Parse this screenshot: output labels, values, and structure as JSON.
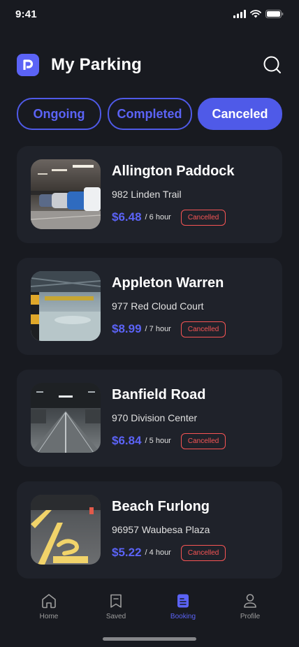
{
  "status_bar": {
    "time": "9:41"
  },
  "header": {
    "title": "My Parking"
  },
  "tabs": [
    {
      "label": "Ongoing",
      "active": false
    },
    {
      "label": "Completed",
      "active": false
    },
    {
      "label": "Canceled",
      "active": true
    }
  ],
  "bookings": [
    {
      "name": "Allington Paddock",
      "address": "982 Linden Trail",
      "price": "$6.48",
      "duration": "/ 6 hour",
      "status": "Cancelled"
    },
    {
      "name": "Appleton Warren",
      "address": "977 Red Cloud Court",
      "price": "$8.99",
      "duration": "/ 7 hour",
      "status": "Cancelled"
    },
    {
      "name": "Banfield Road",
      "address": "970 Division Center",
      "price": "$6.84",
      "duration": "/ 5 hour",
      "status": "Cancelled"
    },
    {
      "name": "Beach Furlong",
      "address": "96957 Waubesa Plaza",
      "price": "$5.22",
      "duration": "/ 4 hour",
      "status": "Cancelled"
    }
  ],
  "bottom_nav": [
    {
      "label": "Home",
      "icon": "home-icon",
      "active": false
    },
    {
      "label": "Saved",
      "icon": "bookmark-icon",
      "active": false
    },
    {
      "label": "Booking",
      "icon": "document-icon",
      "active": true
    },
    {
      "label": "Profile",
      "icon": "profile-icon",
      "active": false
    }
  ],
  "colors": {
    "background": "#181a20",
    "card": "#1f222a",
    "accent": "#5b63f6",
    "cancelled": "#f75555"
  }
}
